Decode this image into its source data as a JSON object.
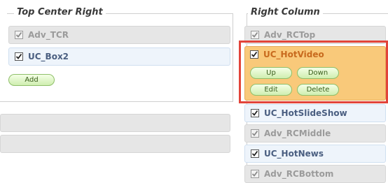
{
  "top_center_right": {
    "legend": "Top Center Right",
    "items": [
      {
        "label": "Adv_TCR",
        "state": "disabled"
      },
      {
        "label": "UC_Box2",
        "state": "enabled"
      }
    ],
    "add_label": "Add"
  },
  "right_column": {
    "legend": "Right Column",
    "items": [
      {
        "label": "Adv_RCTop",
        "state": "disabled"
      },
      {
        "label": "UC_HotVideo",
        "state": "selected"
      },
      {
        "label": "UC_HotSlideShow",
        "state": "enabled"
      },
      {
        "label": "Adv_RCMiddle",
        "state": "disabled"
      },
      {
        "label": "UC_HotNews",
        "state": "enabled"
      },
      {
        "label": "Adv_RCBottom",
        "state": "disabled"
      }
    ],
    "selected_actions": {
      "up": "Up",
      "down": "Down",
      "edit": "Edit",
      "delete": "Delete"
    }
  },
  "colors": {
    "selected_card": "#f9c97a",
    "highlight_outline": "#e2443a",
    "button_green": "#cfeeb0"
  }
}
